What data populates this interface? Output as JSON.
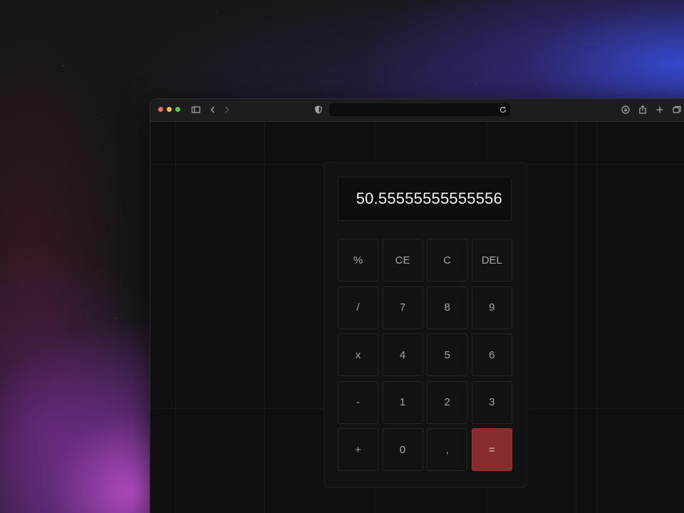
{
  "browser": {
    "icons": [
      "sidebar-icon",
      "back-icon",
      "forward-icon",
      "shield-icon",
      "reload-icon",
      "download-icon",
      "share-icon",
      "new-tab-icon",
      "tabs-overview-icon"
    ]
  },
  "calculator": {
    "display": "50.55555555555556",
    "keys": [
      {
        "label": "%",
        "name": "percent-key"
      },
      {
        "label": "CE",
        "name": "clear-entry-key"
      },
      {
        "label": "C",
        "name": "clear-key"
      },
      {
        "label": "DEL",
        "name": "delete-key"
      },
      {
        "label": "/",
        "name": "divide-key"
      },
      {
        "label": "7",
        "name": "digit-7-key"
      },
      {
        "label": "8",
        "name": "digit-8-key"
      },
      {
        "label": "9",
        "name": "digit-9-key"
      },
      {
        "label": "x",
        "name": "multiply-key"
      },
      {
        "label": "4",
        "name": "digit-4-key"
      },
      {
        "label": "5",
        "name": "digit-5-key"
      },
      {
        "label": "6",
        "name": "digit-6-key"
      },
      {
        "label": "-",
        "name": "subtract-key"
      },
      {
        "label": "1",
        "name": "digit-1-key"
      },
      {
        "label": "2",
        "name": "digit-2-key"
      },
      {
        "label": "3",
        "name": "digit-3-key"
      },
      {
        "label": "+",
        "name": "add-key"
      },
      {
        "label": "0",
        "name": "digit-0-key"
      },
      {
        "label": ",",
        "name": "decimal-comma-key"
      },
      {
        "label": "=",
        "name": "equals-key"
      }
    ],
    "colors": {
      "equals_bg": "#862c2d",
      "key_bg": "#121212",
      "key_text": "#a5a5a7",
      "display_text": "#f2f2f2"
    }
  }
}
